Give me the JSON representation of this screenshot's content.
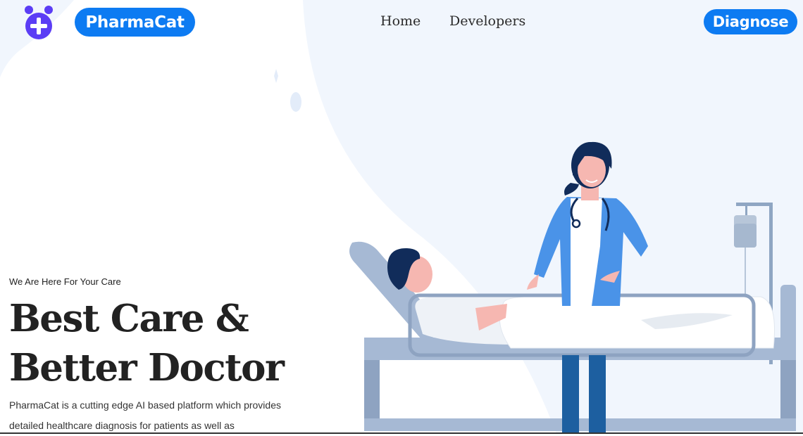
{
  "header": {
    "logo_icon": "cat-medical-cross-icon",
    "brand": "PharmaCat",
    "nav": [
      {
        "label": "Home"
      },
      {
        "label": "Developers"
      }
    ],
    "cta": "Diagnose"
  },
  "hero": {
    "tagline": "We Are Here For Your Care",
    "headline_line1": "Best Care &",
    "headline_line2": "Better Doctor",
    "description": "PharmaCat is a cutting edge AI based platform which provides detailed healthcare diagnosis for patients as well as",
    "illustration": "doctor-and-patient-in-hospital-bed"
  },
  "colors": {
    "accent": "#0d7bf2",
    "logo": "#5b3df5",
    "background_blob": "#f1f6fd",
    "coat": "#4a93e8"
  }
}
